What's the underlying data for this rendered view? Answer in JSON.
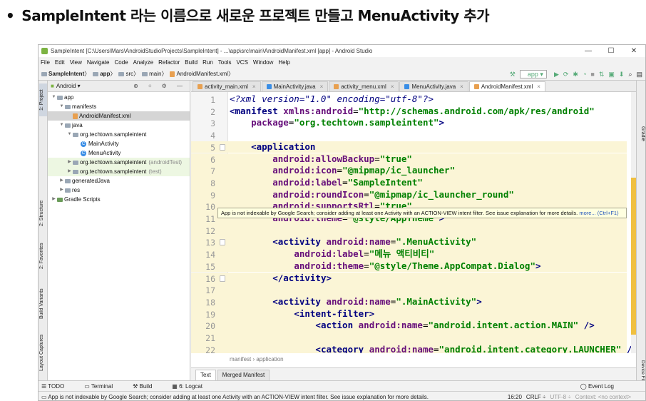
{
  "heading": {
    "bullet": "•",
    "text": "SampleIntent 라는 이름으로 새로운 프로젝트 만들고 MenuActivity 추가"
  },
  "window": {
    "title": "SampleIntent [C:\\Users\\Mars\\AndroidStudioProjects\\SampleIntent] - ...\\app\\src\\main\\AndroidManifest.xml [app] - Android Studio",
    "controls": {
      "minimize": "—",
      "maximize": "☐",
      "close": "✕"
    }
  },
  "menu": [
    "File",
    "Edit",
    "View",
    "Navigate",
    "Code",
    "Analyze",
    "Refactor",
    "Build",
    "Run",
    "Tools",
    "VCS",
    "Window",
    "Help"
  ],
  "navbar": {
    "crumbs": [
      "SampleIntent",
      "app",
      "src",
      "main",
      "AndroidManifest.xml"
    ],
    "run_config": "app"
  },
  "left_tool_tabs": [
    "1: Project",
    "2: Structure",
    "2: Favorites",
    "Build Variants",
    "Layout Captures"
  ],
  "right_tool_tabs": [
    "Gradle",
    "Device File Explorer"
  ],
  "project": {
    "view": "Android",
    "tree": [
      {
        "label": "app",
        "indent": 0,
        "kind": "folder",
        "open": true
      },
      {
        "label": "manifests",
        "indent": 1,
        "kind": "folder",
        "open": true
      },
      {
        "label": "AndroidManifest.xml",
        "indent": 2,
        "kind": "file",
        "selected": true
      },
      {
        "label": "java",
        "indent": 1,
        "kind": "folder",
        "open": true
      },
      {
        "label": "org.techtown.sampleintent",
        "indent": 2,
        "kind": "folder",
        "open": true
      },
      {
        "label": "MainActivity",
        "indent": 3,
        "kind": "class"
      },
      {
        "label": "MenuActivity",
        "indent": 3,
        "kind": "class"
      },
      {
        "label": "org.techtown.sampleintent",
        "suffix": "(androidTest)",
        "indent": 2,
        "kind": "folder",
        "green": true
      },
      {
        "label": "org.techtown.sampleintent",
        "suffix": "(test)",
        "indent": 2,
        "kind": "folder",
        "green": true
      },
      {
        "label": "generatedJava",
        "indent": 1,
        "kind": "folder"
      },
      {
        "label": "res",
        "indent": 1,
        "kind": "folder"
      },
      {
        "label": "Gradle Scripts",
        "indent": 0,
        "kind": "gradle"
      }
    ]
  },
  "editor_tabs": [
    {
      "label": "activity_main.xml",
      "color": "#e8a050"
    },
    {
      "label": "MainActivity.java",
      "color": "#3a8ee6"
    },
    {
      "label": "activity_menu.xml",
      "color": "#e8a050"
    },
    {
      "label": "MenuActivity.java",
      "color": "#3a8ee6"
    },
    {
      "label": "AndroidManifest.xml",
      "color": "#e8a050",
      "active": true
    }
  ],
  "code_lines": [
    {
      "n": "1",
      "hl": false,
      "tokens": [
        [
          "t-pi",
          "<?xml version=\"1.0\" encoding=\"utf-8\"?>"
        ]
      ]
    },
    {
      "n": "2",
      "hl": false,
      "tokens": [
        [
          "t-tag",
          "<manifest "
        ],
        [
          "t-ns",
          "xmlns:android"
        ],
        [
          "t-q",
          "="
        ],
        [
          "t-str",
          "\"http://schemas.android.com/apk/res/android\""
        ]
      ]
    },
    {
      "n": "3",
      "hl": false,
      "tokens": [
        [
          "t-q",
          "    "
        ],
        [
          "t-attr",
          "package"
        ],
        [
          "t-q",
          "="
        ],
        [
          "t-str",
          "\"org.techtown.sampleintent\""
        ],
        [
          "t-tag",
          ">"
        ]
      ]
    },
    {
      "n": "4",
      "hl": false,
      "tokens": []
    },
    {
      "n": "5",
      "hl": true,
      "tokens": [
        [
          "t-q",
          "    "
        ],
        [
          "t-tag",
          "<application"
        ]
      ]
    },
    {
      "n": "6",
      "hl": true,
      "tokens": [
        [
          "t-q",
          "        "
        ],
        [
          "t-attr",
          "android:allowBackup"
        ],
        [
          "t-q",
          "="
        ],
        [
          "t-str",
          "\"true\""
        ]
      ]
    },
    {
      "n": "7",
      "hl": true,
      "tokens": [
        [
          "t-q",
          "        "
        ],
        [
          "t-attr",
          "android:icon"
        ],
        [
          "t-q",
          "="
        ],
        [
          "t-str",
          "\"@mipmap/ic_launcher\""
        ]
      ]
    },
    {
      "n": "8",
      "hl": true,
      "tokens": [
        [
          "t-q",
          "        "
        ],
        [
          "t-attr",
          "android:label"
        ],
        [
          "t-q",
          "="
        ],
        [
          "t-str",
          "\"SampleIntent\""
        ]
      ]
    },
    {
      "n": "9",
      "hl": true,
      "tokens": [
        [
          "t-q",
          "        "
        ],
        [
          "t-attr",
          "android:roundIcon"
        ],
        [
          "t-q",
          "="
        ],
        [
          "t-str",
          "\"@mipmap/ic_launcher_round\""
        ]
      ]
    },
    {
      "n": "10",
      "hl": true,
      "tokens": [
        [
          "t-q",
          "        "
        ],
        [
          "t-attr",
          "android:supportsRtl"
        ],
        [
          "t-q",
          "="
        ],
        [
          "t-str",
          "\"true\""
        ]
      ]
    },
    {
      "n": "11",
      "hl": true,
      "tokens": [
        [
          "t-q",
          "        "
        ],
        [
          "t-attr",
          "android:theme"
        ],
        [
          "t-q",
          "="
        ],
        [
          "t-str",
          "\"@style/AppTheme\""
        ],
        [
          "t-tag",
          ">"
        ]
      ]
    },
    {
      "n": "12",
      "hl": true,
      "tokens": []
    },
    {
      "n": "13",
      "hl": true,
      "tokens": [
        [
          "t-q",
          "        "
        ],
        [
          "t-tag",
          "<activity "
        ],
        [
          "t-attr",
          "android:name"
        ],
        [
          "t-q",
          "="
        ],
        [
          "t-str",
          "\".MenuActivity\""
        ]
      ]
    },
    {
      "n": "14",
      "hl": true,
      "tokens": [
        [
          "t-q",
          "            "
        ],
        [
          "t-attr",
          "android:label"
        ],
        [
          "t-q",
          "="
        ],
        [
          "t-str",
          "\"메뉴 액티비티\""
        ]
      ]
    },
    {
      "n": "15",
      "hl": true,
      "tokens": [
        [
          "t-q",
          "            "
        ],
        [
          "t-attr",
          "android:theme"
        ],
        [
          "t-q",
          "="
        ],
        [
          "t-str",
          "\"@style/Theme.AppCompat.Dialog\""
        ],
        [
          "t-tag",
          ">"
        ]
      ]
    },
    {
      "n": "16",
      "hl": true,
      "tokens": [
        [
          "t-q",
          "        "
        ],
        [
          "t-tag",
          "</activity>"
        ]
      ]
    },
    {
      "n": "17",
      "hl": true,
      "tokens": []
    },
    {
      "n": "18",
      "hl": true,
      "tokens": [
        [
          "t-q",
          "        "
        ],
        [
          "t-tag",
          "<activity "
        ],
        [
          "t-attr",
          "android:name"
        ],
        [
          "t-q",
          "="
        ],
        [
          "t-str",
          "\".MainActivity\""
        ],
        [
          "t-tag",
          ">"
        ]
      ]
    },
    {
      "n": "19",
      "hl": true,
      "tokens": [
        [
          "t-q",
          "            "
        ],
        [
          "t-tag",
          "<intent-filter>"
        ]
      ]
    },
    {
      "n": "20",
      "hl": true,
      "tokens": [
        [
          "t-q",
          "                "
        ],
        [
          "t-tag",
          "<action "
        ],
        [
          "t-attr",
          "android:name"
        ],
        [
          "t-q",
          "="
        ],
        [
          "t-str",
          "\"android.intent.action.MAIN\""
        ],
        [
          "t-tag",
          " />"
        ]
      ]
    },
    {
      "n": "21",
      "hl": true,
      "tokens": []
    },
    {
      "n": "22",
      "hl": true,
      "tokens": [
        [
          "t-q",
          "                "
        ],
        [
          "t-tag",
          "<category "
        ],
        [
          "t-attr",
          "android:name"
        ],
        [
          "t-q",
          "="
        ],
        [
          "t-str",
          "\"android.intent.category.LAUNCHER\""
        ],
        [
          "t-tag",
          " />"
        ]
      ]
    }
  ],
  "tooltip": {
    "text": "App is not indexable by Google Search; consider adding at least one Activity with an ACTION-VIEW intent filter. See issue explanation for more details. ",
    "more": "more... (Ctrl+F1)"
  },
  "editor_breadcrumb": "manifest  ›  application",
  "bottom_tabs": [
    "Text",
    "Merged Manifest"
  ],
  "tool_windows": [
    "TODO",
    "Terminal",
    "Build",
    "6: Logcat"
  ],
  "event_log": "Event Log",
  "status": {
    "message": "App is not indexable by Google Search; consider adding at least one Activity with an ACTION-VIEW intent filter. See issue explanation for more details.",
    "position": "16:20",
    "line_sep": "CRLF ÷",
    "encoding": "UTF-8 ÷",
    "context": "Context: <no context>"
  }
}
